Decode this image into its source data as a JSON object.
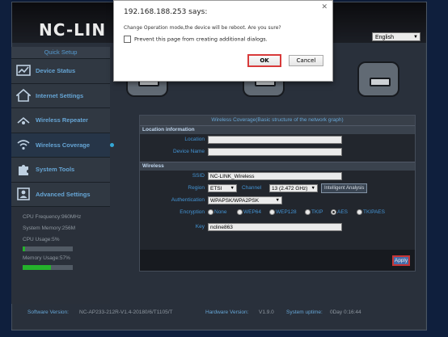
{
  "header": {
    "logo_text": "NC-LIN",
    "language_select": {
      "value": "English"
    }
  },
  "sidebar": {
    "header": "Quick Setup",
    "items": [
      {
        "label": "Device Status",
        "icon": "monitor-graph-icon"
      },
      {
        "label": "Internet Settings",
        "icon": "house-icon"
      },
      {
        "label": "Wireless Repeater",
        "icon": "repeater-signal-icon"
      },
      {
        "label": "Wireless Coverage",
        "icon": "wifi-icon"
      },
      {
        "label": "System Tools",
        "icon": "puzzle-icon"
      },
      {
        "label": "Advanced Settings",
        "icon": "user-icon"
      }
    ],
    "active_item": "Wireless Coverage",
    "system_info": {
      "cpu_frequency": "CPU Frequency:960MHz",
      "system_memory": "System Memory:256M",
      "cpu_usage_label": "CPU Usage:5%",
      "cpu_usage_percent": 5,
      "memory_usage_label": "Memory Usage:57%",
      "memory_usage_percent": 57
    }
  },
  "panel": {
    "title": "Wireless Coverage(Basic structure of the network graph)",
    "location_section": {
      "heading": "Location information",
      "location_label": "Location",
      "location_value": "",
      "device_name_label": "Device Name",
      "device_name_value": ""
    },
    "wireless_section": {
      "heading": "Wireless",
      "ssid_label": "SSID",
      "ssid_value": "NC-LINK_Wireless",
      "region_label": "Region",
      "region_value": "ETSI",
      "channel_label": "Channel",
      "channel_value": "13 (2.472 GHz)",
      "intelligent_button": "Intelligent Analysis",
      "authentication_label": "Authentication",
      "authentication_value": "WPAPSK/WPA2PSK",
      "encryption_label": "Encryption",
      "encryption_options": [
        "None",
        "WEP64",
        "WEP128",
        "TKIP",
        "AES",
        "TKIPAES"
      ],
      "encryption_selected": "AES",
      "key_label": "Key",
      "key_value": "ncline863"
    },
    "apply_button": "Apply"
  },
  "footer": {
    "software_label": "Software Version:",
    "software_value": "NC-AP233-212R-V1.4-20180/6/T1105/T",
    "hardware_label": "Hardware Version:",
    "hardware_value": "V1.9.0",
    "uptime_label": "System uptime:",
    "uptime_value": "0Day 0:16:44"
  },
  "dialog": {
    "title": "192.168.188.253 says:",
    "message": "Change Operation mode,the device will be reboot. Are you sure?",
    "checkbox_label": "Prevent this page from creating additional dialogs.",
    "ok_label": "OK",
    "cancel_label": "Cancel"
  },
  "colors": {
    "accent_label": "#4aa0e6",
    "progress_fill": "#28c02f",
    "highlight_border": "#d83a3a"
  }
}
